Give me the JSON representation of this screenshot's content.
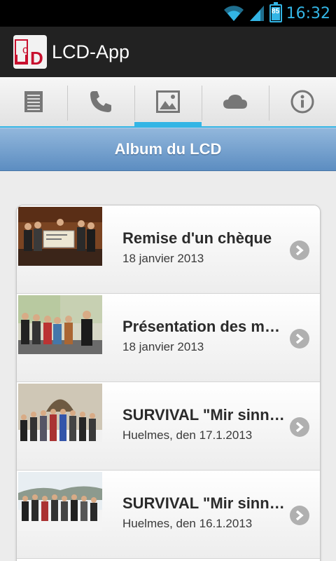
{
  "status_bar": {
    "time": "16:32",
    "battery": "85",
    "battery_level": 0.85,
    "icons": [
      "wifi-icon",
      "signal-icon",
      "battery-icon"
    ]
  },
  "action_bar": {
    "title": "LCD-App",
    "logo_icon": "lcd-logo",
    "logo_text": "LCD"
  },
  "tabs": [
    {
      "icon": "list-icon",
      "active": false
    },
    {
      "icon": "phone-icon",
      "active": false
    },
    {
      "icon": "image-icon",
      "active": true
    },
    {
      "icon": "cloud-icon",
      "active": false
    },
    {
      "icon": "info-icon",
      "active": false
    }
  ],
  "section": {
    "title": "Album du LCD"
  },
  "album": {
    "items": [
      {
        "title": "Remise d'un chèque",
        "date": "18 janvier 2013"
      },
      {
        "title": "Présentation des métiers",
        "date": "18 janvier 2013"
      },
      {
        "title": "SURVIVAL \"Mir sinn dobäi\"",
        "date": "Huelmes, den 17.1.2013"
      },
      {
        "title": "SURVIVAL \"Mir sinn dobäi\"",
        "date": "Huelmes, den 16.1.2013"
      }
    ]
  },
  "colors": {
    "accent": "#33b5e5",
    "header": "#6b9bcc",
    "brand_red": "#c8102e"
  }
}
